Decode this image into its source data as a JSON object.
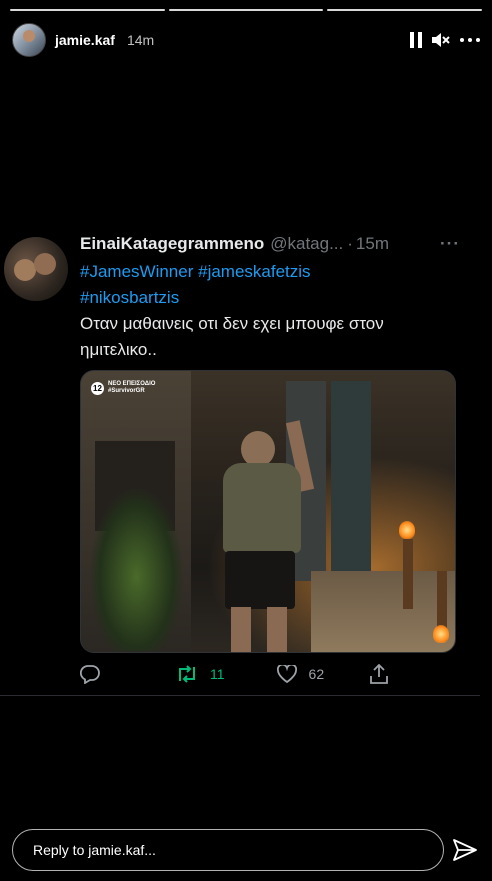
{
  "story": {
    "progress_segments": 3,
    "username": "jamie.kaf",
    "time": "14m",
    "icons": {
      "pause": "pause-icon",
      "mute": "speaker-muted-icon",
      "more": "more-horizontal-icon",
      "send": "send-paper-plane-icon"
    }
  },
  "tweet": {
    "name": "EinaiKatagegrammeno",
    "handle": "@katag...",
    "dot": "·",
    "age": "15m",
    "more": "···",
    "hashtags": [
      "#JamesWinner",
      "#jameskafetzis",
      "#nikosbartzis"
    ],
    "text": "Οταν μαθαινεις οτι δεν εχει μπουφε στον ημιτελικο..",
    "media": {
      "badge_number": "12",
      "badge_line1": "ΝΕΟ ΕΠΕΙΣΟΔΙΟ",
      "badge_line2": "#SurvivorGR"
    },
    "actions": {
      "retweets": "11",
      "likes": "62"
    },
    "colors": {
      "link": "#1d9bf0",
      "retweet": "#00ba7c",
      "muted": "#71767b"
    }
  },
  "reply": {
    "placeholder": "Reply to jamie.kaf..."
  }
}
